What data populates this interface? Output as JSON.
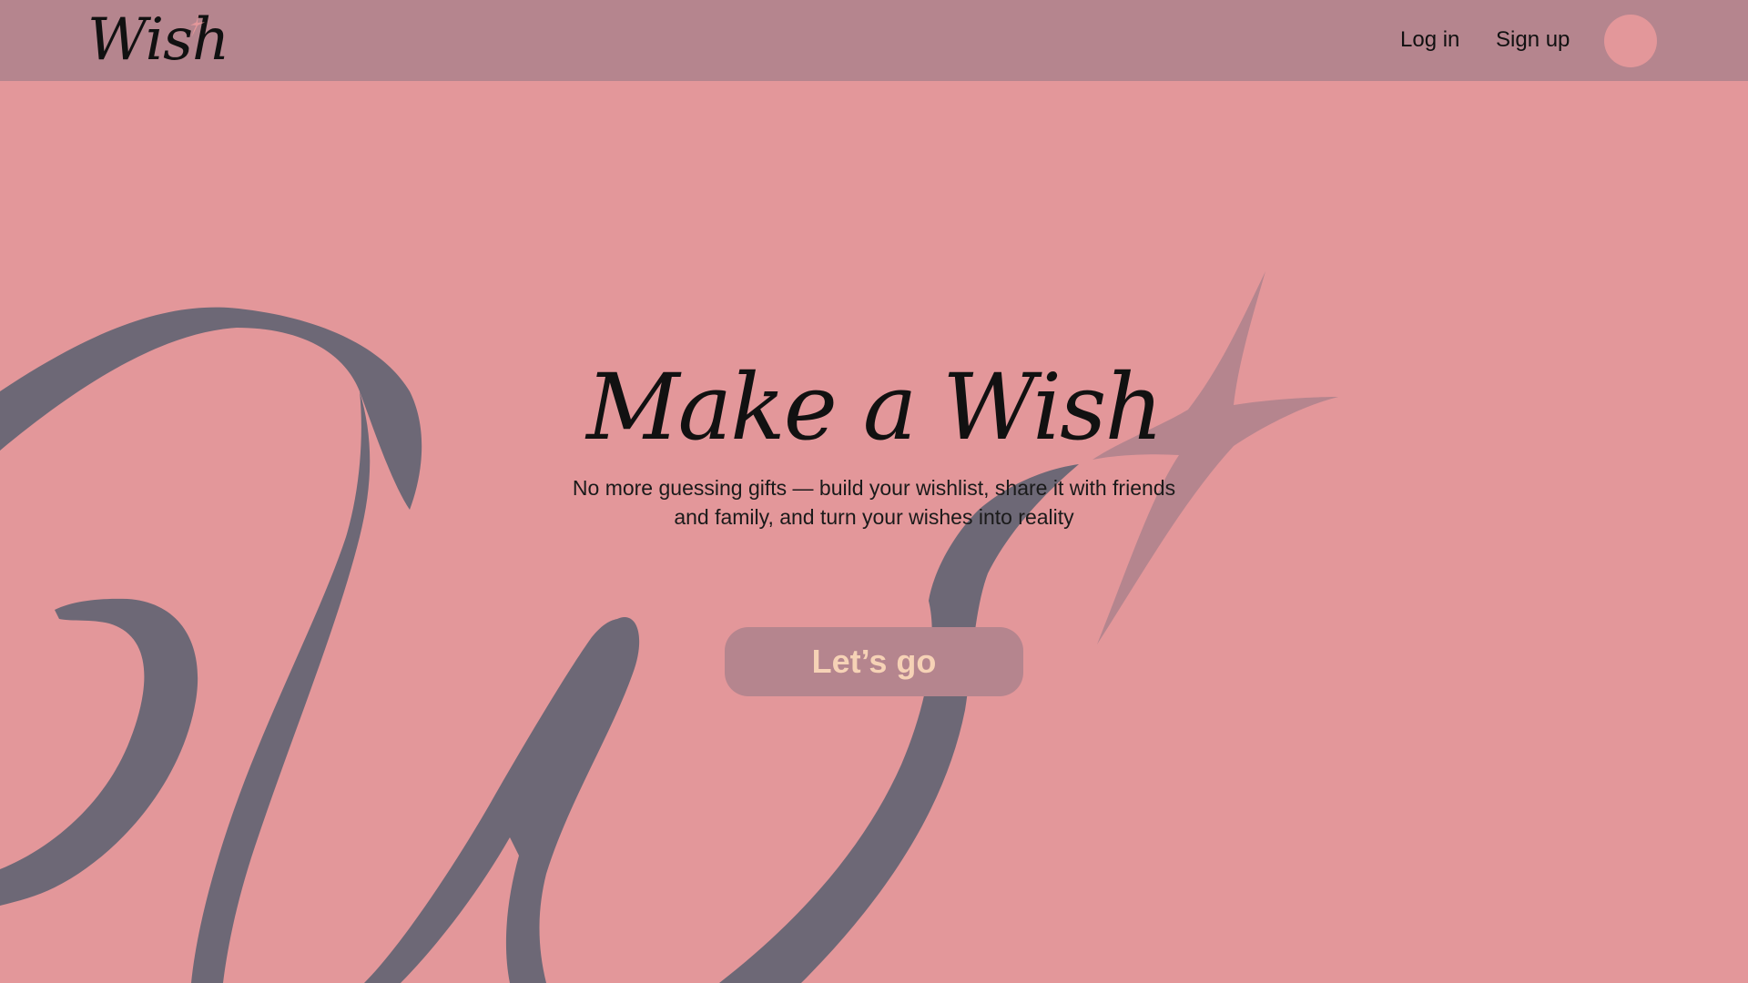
{
  "header": {
    "logo_text": "Wish",
    "nav": {
      "login": "Log in",
      "signup": "Sign up"
    }
  },
  "hero": {
    "title": "Make a Wish",
    "subtitle": "No more guessing gifts — build your wishlist, share it with friends and family, and turn your wishes into reality",
    "cta_label": "Let’s go"
  },
  "colors": {
    "background": "#e3979a",
    "header": "#b5858e",
    "decorative_script": "#6d6876",
    "decorative_star": "#b5858e",
    "cta_background": "#b5858e",
    "cta_text": "#f6d2b6",
    "logo_star": "#e3979a"
  },
  "icons": {
    "logo_sparkle": "sparkle-icon",
    "background_sparkle": "sparkle-icon",
    "avatar": "avatar-circle"
  }
}
